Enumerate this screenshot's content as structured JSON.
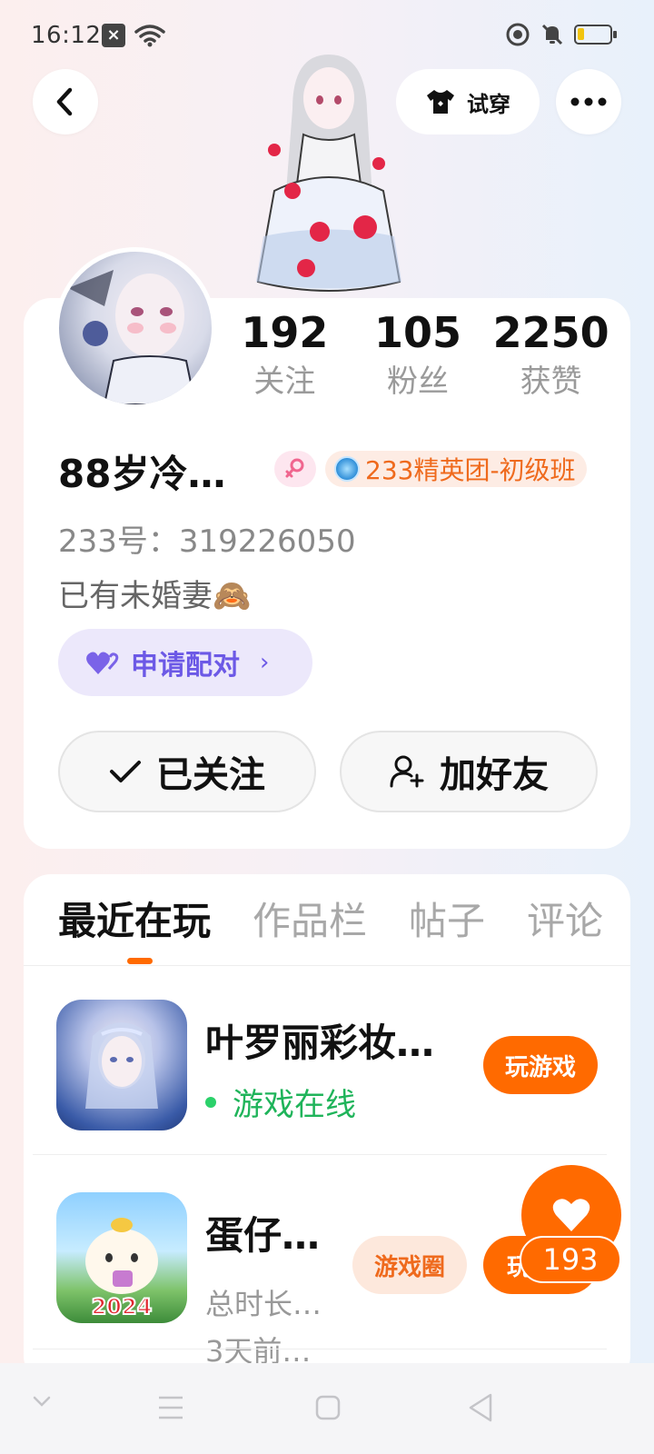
{
  "status_bar": {
    "time": "16:12",
    "notification_icon": "x-square-icon",
    "wifi_icon": "wifi-icon",
    "dnd_icon": "do-not-disturb-icon",
    "mute_icon": "bell-off-icon",
    "battery_icon": "battery-icon",
    "battery_level": 0.2
  },
  "header": {
    "back_icon": "chevron-left-icon",
    "tryon_label": "试穿",
    "tryon_icon": "shirt-icon",
    "more_icon": "more-icon"
  },
  "profile": {
    "stats": [
      {
        "value": "192",
        "label": "关注"
      },
      {
        "value": "105",
        "label": "粉丝"
      },
      {
        "value": "2250",
        "label": "获赞"
      }
    ],
    "username": "88岁冷…",
    "gender_icon": "female-icon",
    "level_badge": "233精英团-初级班",
    "user_id": "233号：319226050",
    "bio": "已有未婚妻🙈",
    "match_button": "申请配对",
    "follow_button": "已关注",
    "add_friend_button": "加好友"
  },
  "tabs": [
    {
      "label": "最近在玩",
      "active": true
    },
    {
      "label": "作品栏",
      "active": false
    },
    {
      "label": "帖子",
      "active": false
    },
    {
      "label": "评论",
      "active": false
    }
  ],
  "games": [
    {
      "title": "叶罗丽彩妆…",
      "status": "游戏在线",
      "play_label": "玩游戏"
    },
    {
      "title": "蛋仔…",
      "duration": "总时长…",
      "last_played": "3天前…",
      "circle_label": "游戏圈",
      "play_label": "玩",
      "icon_text": "2024"
    }
  ],
  "like": {
    "icon": "heart-icon",
    "count": "193"
  },
  "nav": {
    "collapse_icon": "chevron-down-icon",
    "menu_icon": "menu-icon",
    "home_icon": "square-icon",
    "back_icon": "triangle-back-icon"
  }
}
